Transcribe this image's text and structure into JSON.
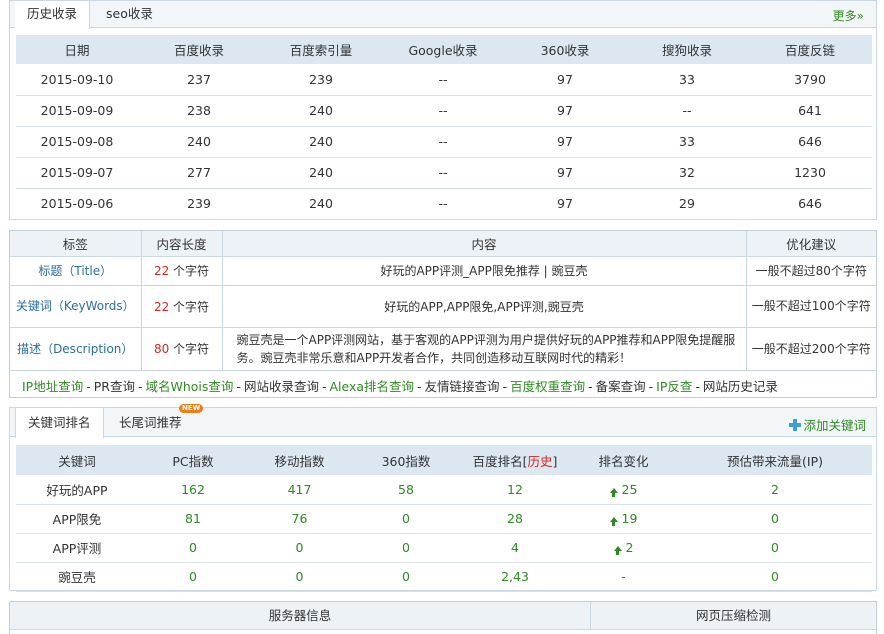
{
  "history_panel": {
    "tabs": [
      "历史收录",
      "seo收录"
    ],
    "more_label": "更多»",
    "columns": [
      "日期",
      "百度收录",
      "百度索引量",
      "Google收录",
      "360收录",
      "搜狗收录",
      "百度反链"
    ],
    "rows": [
      [
        "2015-09-10",
        "237",
        "239",
        "--",
        "97",
        "33",
        "3790"
      ],
      [
        "2015-09-09",
        "238",
        "240",
        "--",
        "97",
        "--",
        "641"
      ],
      [
        "2015-09-08",
        "240",
        "240",
        "--",
        "97",
        "33",
        "646"
      ],
      [
        "2015-09-07",
        "277",
        "240",
        "--",
        "97",
        "32",
        "1230"
      ],
      [
        "2015-09-06",
        "239",
        "240",
        "--",
        "97",
        "29",
        "646"
      ]
    ]
  },
  "meta_panel": {
    "columns": [
      "标签",
      "内容长度",
      "内容",
      "优化建议"
    ],
    "rows": [
      {
        "label": "标题（Title）",
        "length": "22",
        "unit": "个字符",
        "content": "好玩的APP评测_APP限免推荐 | 豌豆壳",
        "suggest": "一般不超过80个字符"
      },
      {
        "label": "关键词（KeyWords）",
        "length": "22",
        "unit": "个字符",
        "content": "好玩的APP,APP限免,APP评测,豌豆壳",
        "suggest": "一般不超过100个字符"
      },
      {
        "label": "描述（Description）",
        "length": "80",
        "unit": "个字符",
        "content": "豌豆壳是一个APP评测网站，基于客观的APP评测为用户提供好玩的APP推荐和APP限免提醒服务。豌豆壳非常乐意和APP开发者合作，共同创造移动互联网时代的精彩！",
        "suggest": "一般不超过200个字符"
      }
    ],
    "tools": [
      "IP地址查询",
      "PR查询",
      "域名Whois查询",
      "网站收录查询",
      "Alexa排名查询",
      "友情链接查询",
      "百度权重查询",
      "备案查询",
      "IP反查",
      "网站历史记录"
    ],
    "separator": "-"
  },
  "keyword_panel": {
    "tabs": [
      "关键词排名",
      "长尾词推荐"
    ],
    "new_badge": "NEW",
    "add_label": "添加关键词",
    "columns": [
      "关键词",
      "PC指数",
      "移动指数",
      "360指数",
      "百度排名",
      "排名变化",
      "预估带来流量(IP)"
    ],
    "history_label": "历史",
    "rows": [
      {
        "kw": "好玩的APP",
        "pc": "162",
        "mobile": "417",
        "s360": "58",
        "rank": "12",
        "change": "25",
        "traffic": "2"
      },
      {
        "kw": "APP限免",
        "pc": "81",
        "mobile": "76",
        "s360": "0",
        "rank": "28",
        "change": "19",
        "traffic": "0"
      },
      {
        "kw": "APP评测",
        "pc": "0",
        "mobile": "0",
        "s360": "0",
        "rank": "4",
        "change": "2",
        "traffic": "0"
      },
      {
        "kw": "豌豆壳",
        "pc": "0",
        "mobile": "0",
        "s360": "0",
        "rank": "2,43",
        "change": "-",
        "traffic": "0"
      }
    ]
  },
  "bottom_panel": {
    "left_title": "服务器信息",
    "right_title": "网页压缩检测"
  },
  "colors": {
    "green_link": "#2e8b22",
    "red_number": "#d8261f",
    "header_bg": "#dde7f1",
    "border": "#c9d7e3"
  }
}
